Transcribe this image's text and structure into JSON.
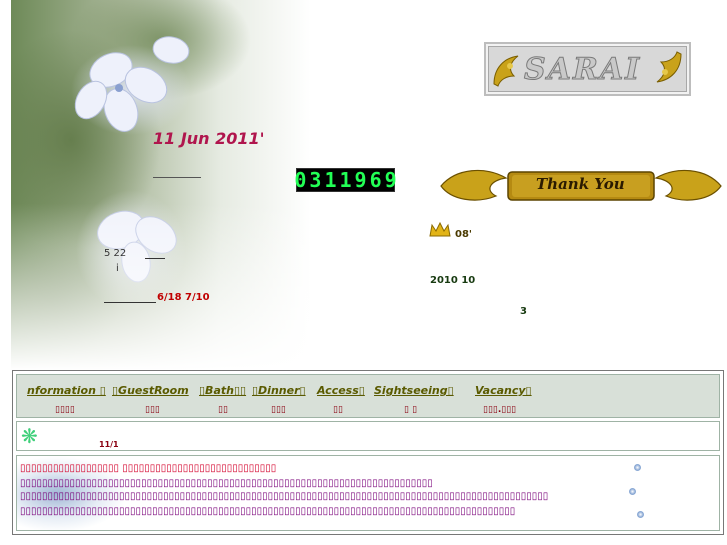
{
  "header": {
    "date": "11 Jun 2011'",
    "counter": [
      "0",
      "3",
      "1",
      "1",
      "9",
      "6",
      "9"
    ],
    "logo_text": "SARAI",
    "thank_you": "Thank You",
    "note1": "5 22",
    "note2": "i",
    "note3": "6/18  7/10",
    "crown_text": "08'",
    "year_text": "2010   10",
    "three_text": "3"
  },
  "nav": {
    "items": [
      {
        "label": "nformation ▯",
        "sub": "▯▯▯▯"
      },
      {
        "label": "▯GuestRoom",
        "sub": "▯▯▯"
      },
      {
        "label": "▯Bath▯▯",
        "sub": "▯▯"
      },
      {
        "label": "▯Dinner▯",
        "sub": "▯▯▯"
      },
      {
        "label": "Access▯",
        "sub": "▯▯"
      },
      {
        "label": "Sightseeing▯",
        "sub": "▯ ▯"
      },
      {
        "label": "Vacancy▯",
        "sub": "▯▯▯.▯▯▯"
      }
    ]
  },
  "news": {
    "icon": "sparkle-icon",
    "date": "11/1"
  },
  "info": {
    "lines": [
      {
        "text": "▯▯▯▯▯▯▯▯▯▯▯▯▯▯▯▯▯▯ ▯▯▯▯▯▯▯▯▯▯▯▯▯▯▯▯▯▯▯▯▯▯▯▯▯▯▯▯",
        "color": "#d4002a"
      },
      {
        "text": "▯▯▯▯▯▯▯▯▯▯▯▯▯▯▯▯▯▯▯▯▯▯▯▯▯▯▯▯▯▯▯▯▯▯▯▯▯▯▯▯▯▯▯▯▯▯▯▯▯▯▯▯▯▯▯▯▯▯▯▯▯▯▯▯▯▯▯▯▯▯▯▯▯▯▯",
        "color": "#7a007a"
      },
      {
        "text": "▯▯▯▯▯▯▯▯▯▯▯▯▯▯▯▯▯▯▯▯▯▯▯▯▯▯▯▯▯▯▯▯▯▯▯▯▯▯▯▯▯▯▯▯▯▯▯▯▯▯▯▯▯▯▯▯▯▯▯▯▯▯▯▯▯▯▯▯▯▯▯▯▯▯▯▯▯▯▯▯▯▯▯▯▯▯▯▯▯▯▯▯▯▯▯▯",
        "color": "#7a007a"
      },
      {
        "text": "▯▯▯▯▯▯▯▯▯▯▯▯▯▯▯▯▯▯▯▯▯▯▯▯▯▯▯▯▯▯▯▯▯▯▯▯▯▯▯▯▯▯▯▯▯▯▯▯▯▯▯▯▯▯▯▯▯▯▯▯▯▯▯▯▯▯▯▯▯▯▯▯▯▯▯▯▯▯▯▯▯▯▯▯▯▯▯▯▯▯",
        "color": "#7a007a"
      }
    ]
  },
  "colors": {
    "date": "#b0154d",
    "counter_digits": "#22ff55",
    "nav_bg": "#d8e0d8",
    "nav_link": "#5a5a00",
    "nav_sub": "#8a0010",
    "gold": "#c9a21a"
  }
}
